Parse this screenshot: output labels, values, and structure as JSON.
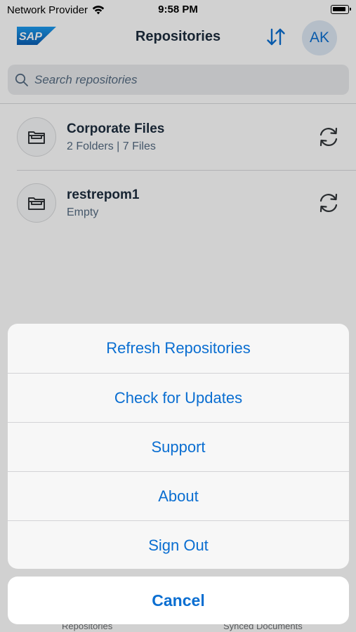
{
  "status_bar": {
    "carrier": "Network Provider",
    "time": "9:58 PM"
  },
  "nav": {
    "title": "Repositories",
    "avatar_initials": "AK",
    "logo_text": "SAP"
  },
  "search": {
    "placeholder": "Search repositories"
  },
  "repositories": [
    {
      "name": "Corporate Files",
      "subtitle": "2 Folders | 7 Files"
    },
    {
      "name": "restrepom1",
      "subtitle": "Empty"
    }
  ],
  "tab_bar": {
    "tabs": [
      "Repositories",
      "Synced Documents"
    ]
  },
  "action_sheet": {
    "items": [
      "Refresh Repositories",
      "Check for Updates",
      "Support",
      "About",
      "Sign Out"
    ],
    "cancel_label": "Cancel"
  },
  "colors": {
    "accent": "#0a6ed1",
    "title": "#1d2d3e",
    "secondary_text": "#556b82"
  },
  "icons": {
    "wifi": "wifi-icon",
    "battery": "battery-icon",
    "sort": "sort-icon",
    "search": "search-icon",
    "folder": "folder-icon",
    "sync": "sync-icon"
  }
}
